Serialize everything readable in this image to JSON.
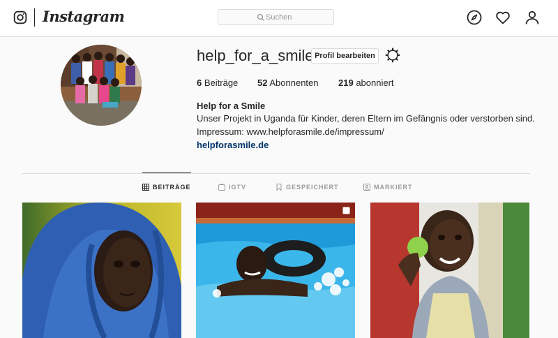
{
  "nav": {
    "wordmark": "Instagram",
    "search_placeholder": "Suchen",
    "icons": [
      "instagram-glyph-icon",
      "search-icon",
      "compass-icon",
      "heart-icon",
      "person-icon"
    ]
  },
  "profile": {
    "username": "help_for_a_smile",
    "edit_button": "Profil bearbeiten",
    "stats": {
      "posts_count": "6",
      "posts_label": "Beiträge",
      "followers_count": "52",
      "followers_label": "Abonnenten",
      "following_count": "219",
      "following_label": "abonniert"
    },
    "bio": {
      "name": "Help for a Smile",
      "line1": "Unser Projekt in Uganda für Kinder, deren Eltern im Gefängnis oder verstorben sind.",
      "line2": "Impressum: www.helpforasmile.de/impressum/",
      "link": "helpforasmile.de"
    }
  },
  "tabs": [
    {
      "label": "BEITRÄGE",
      "active": true,
      "icon": "grid-icon"
    },
    {
      "label": "IGTV",
      "active": false,
      "icon": "igtv-icon"
    },
    {
      "label": "GESPEICHERT",
      "active": false,
      "icon": "bookmark-icon"
    },
    {
      "label": "MARKIERT",
      "active": false,
      "icon": "tag-person-icon"
    }
  ],
  "colors": {
    "background": "#fafafa",
    "border": "#dbdbdb",
    "text": "#262626",
    "muted": "#999999",
    "link": "#003569"
  }
}
